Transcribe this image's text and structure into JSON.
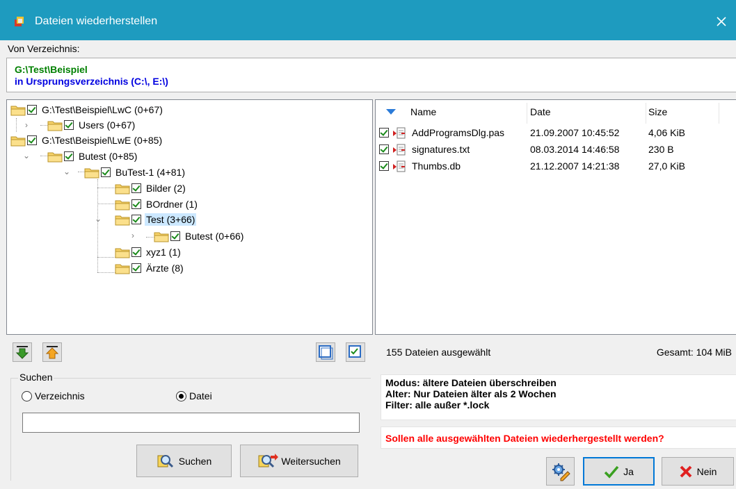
{
  "window": {
    "title": "Dateien wiederherstellen",
    "close_icon": "close-icon",
    "accent_color": "#1e9bbf"
  },
  "source": {
    "label": "Von Verzeichnis:",
    "path": "G:\\Test\\Beispiel",
    "target": "in Ursprungsverzeichnis (C:\\, E:\\)"
  },
  "tree": {
    "nodes": [
      {
        "label": "G:\\Test\\Beispiel\\LwC (0+67)",
        "expander": ""
      },
      {
        "label": "Users (0+67)",
        "expander": "›"
      },
      {
        "label": "G:\\Test\\Beispiel\\LwE (0+85)",
        "expander": ""
      },
      {
        "label": "Butest (0+85)",
        "expander": "⌄"
      },
      {
        "label": "BuTest-1 (4+81)",
        "expander": "⌄"
      },
      {
        "label": "Bilder (2)",
        "expander": ""
      },
      {
        "label": "BOrdner (1)",
        "expander": ""
      },
      {
        "label": "Test (3+66)",
        "expander": "⌄",
        "selected": true
      },
      {
        "label": "Butest (0+66)",
        "expander": "›"
      },
      {
        "label": "xyz1 (1)",
        "expander": ""
      },
      {
        "label": "Ärzte (8)",
        "expander": ""
      }
    ]
  },
  "files": {
    "columns": {
      "name": "Name",
      "date": "Date",
      "size": "Size"
    },
    "rows": [
      {
        "name": "AddProgramsDlg.pas",
        "date": "21.09.2007 10:45:52",
        "size": "4,06 KiB"
      },
      {
        "name": "signatures.txt",
        "date": "08.03.2014 14:46:58",
        "size": "230 B"
      },
      {
        "name": "Thumbs.db",
        "date": "21.12.2007 14:21:38",
        "size": "27,0 KiB"
      }
    ]
  },
  "search": {
    "legend": "Suchen",
    "radio_dir": "Verzeichnis",
    "radio_file": "Datei",
    "selected": "Datei",
    "input_value": "",
    "search_button": "Suchen",
    "next_button": "Weitersuchen"
  },
  "status": {
    "selected_count": "155 Dateien ausgewählt",
    "total": "Gesamt: 104 MiB"
  },
  "info": {
    "mode": "Modus: ältere Dateien überschreiben",
    "age": "Alter: Nur Dateien älter als 2 Wochen",
    "filter": "Filter: alle außer *.lock"
  },
  "question": "Sollen alle ausgewählten Dateien wiederhergestellt werden?",
  "actions": {
    "yes": "Ja",
    "no": "Nein"
  },
  "colors": {
    "path_green": "#008000",
    "path_blue": "#0000e0",
    "question_red": "#ff0000",
    "selection": "#cce8ff"
  }
}
